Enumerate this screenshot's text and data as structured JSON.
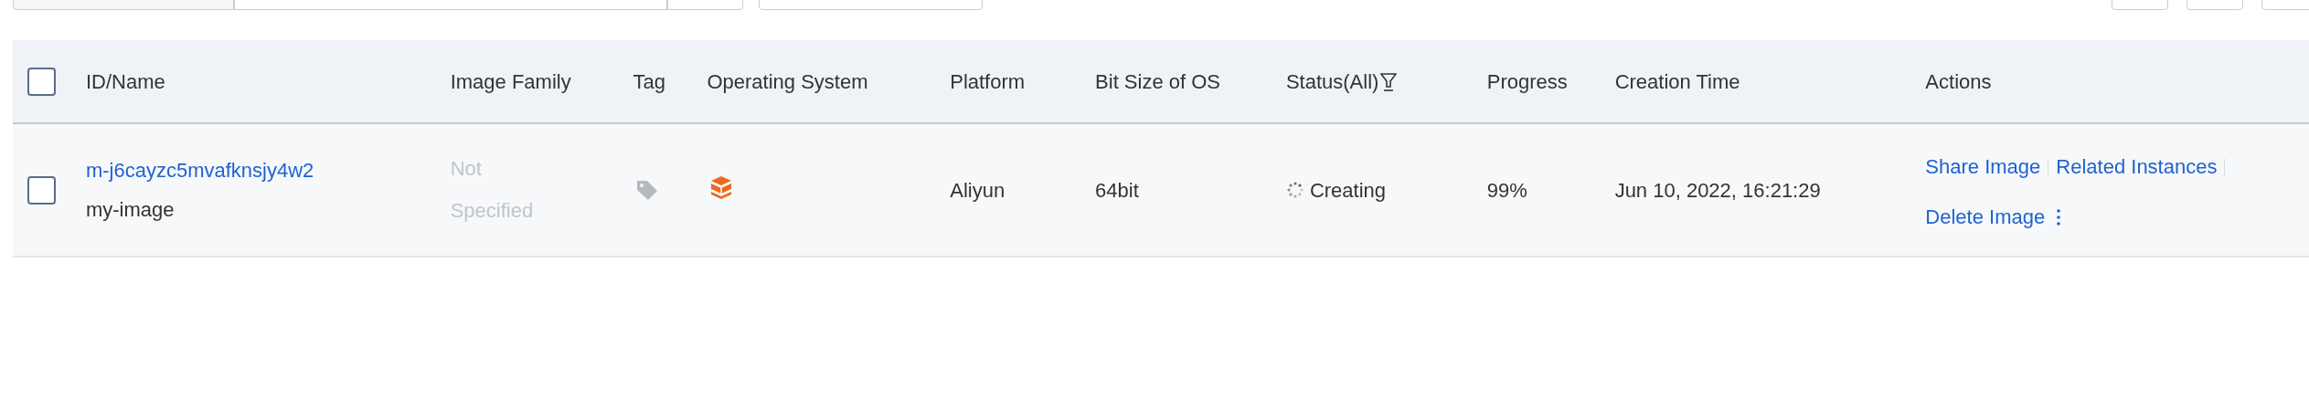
{
  "toolbar": {
    "left_controls": [
      {
        "kind": "select"
      },
      {
        "kind": "field"
      },
      {
        "kind": "button"
      },
      {
        "kind": "select"
      }
    ],
    "right_controls": [
      {
        "kind": "button"
      },
      {
        "kind": "button"
      },
      {
        "kind": "button"
      }
    ]
  },
  "table": {
    "select_all": {
      "checked": false
    },
    "columns": [
      "ID/Name",
      "Image Family",
      "Tag",
      "Operating System",
      "Platform",
      "Bit Size of OS",
      "Status(All)",
      "Progress",
      "Creation Time",
      "Actions"
    ],
    "rows": [
      {
        "checked": false,
        "id": "m-j6cayzc5mvafknsjy4w2",
        "name": "my-image",
        "image_family": "Not Specified",
        "platform": "Aliyun",
        "bit_size": "64bit",
        "status": "Creating",
        "progress": "99%",
        "creation_time": "Jun 10, 2022, 16:21:29",
        "actions": [
          "Share Image",
          "Related Instances",
          "Delete Image"
        ]
      }
    ]
  }
}
